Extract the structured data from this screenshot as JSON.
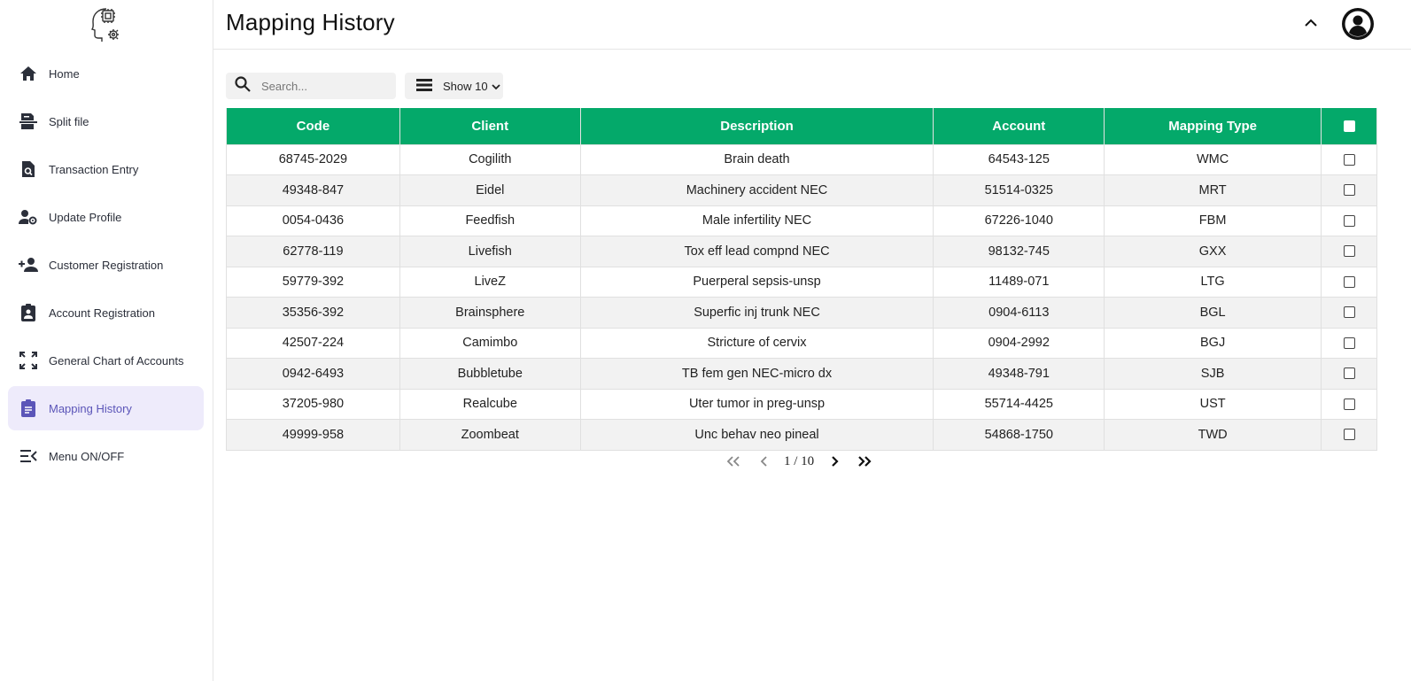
{
  "sidebar": {
    "items": [
      {
        "label": "Home",
        "icon": "home-icon"
      },
      {
        "label": "Split file",
        "icon": "split-file-icon"
      },
      {
        "label": "Transaction Entry",
        "icon": "document-search-icon"
      },
      {
        "label": "Update Profile",
        "icon": "user-gear-icon"
      },
      {
        "label": "Customer Registration",
        "icon": "person-add-icon"
      },
      {
        "label": "Account Registration",
        "icon": "badge-icon"
      },
      {
        "label": "General Chart of Accounts",
        "icon": "expand-icon"
      },
      {
        "label": "Mapping History",
        "icon": "clipboard-icon",
        "active": true
      },
      {
        "label": "Menu ON/OFF",
        "icon": "menu-toggle-icon"
      }
    ]
  },
  "header": {
    "title": "Mapping History"
  },
  "toolbar": {
    "search_placeholder": "Search...",
    "show_label": "Show 10"
  },
  "table": {
    "columns": [
      "Code",
      "Client",
      "Description",
      "Account",
      "Mapping Type"
    ],
    "rows": [
      [
        "68745-2029",
        "Cogilith",
        "Brain death",
        "64543-125",
        "WMC"
      ],
      [
        "49348-847",
        "Eidel",
        "Machinery accident NEC",
        "51514-0325",
        "MRT"
      ],
      [
        "0054-0436",
        "Feedfish",
        "Male infertility NEC",
        "67226-1040",
        "FBM"
      ],
      [
        "62778-119",
        "Livefish",
        "Tox eff lead compnd NEC",
        "98132-745",
        "GXX"
      ],
      [
        "59779-392",
        "LiveZ",
        "Puerperal sepsis-unsp",
        "11489-071",
        "LTG"
      ],
      [
        "35356-392",
        "Brainsphere",
        "Superfic inj trunk NEC",
        "0904-6113",
        "BGL"
      ],
      [
        "42507-224",
        "Camimbo",
        "Stricture of cervix",
        "0904-2992",
        "BGJ"
      ],
      [
        "0942-6493",
        "Bubbletube",
        "TB fem gen NEC-micro dx",
        "49348-791",
        "SJB"
      ],
      [
        "37205-980",
        "Realcube",
        "Uter tumor in preg-unsp",
        "55714-4425",
        "UST"
      ],
      [
        "49999-958",
        "Zoombeat",
        "Unc behav neo pineal",
        "54868-1750",
        "TWD"
      ]
    ]
  },
  "pagination": {
    "label": "1 / 10"
  },
  "colors": {
    "accent": "#04a96a",
    "active_bg": "#eeebfb",
    "active_text": "#5b55b8"
  }
}
